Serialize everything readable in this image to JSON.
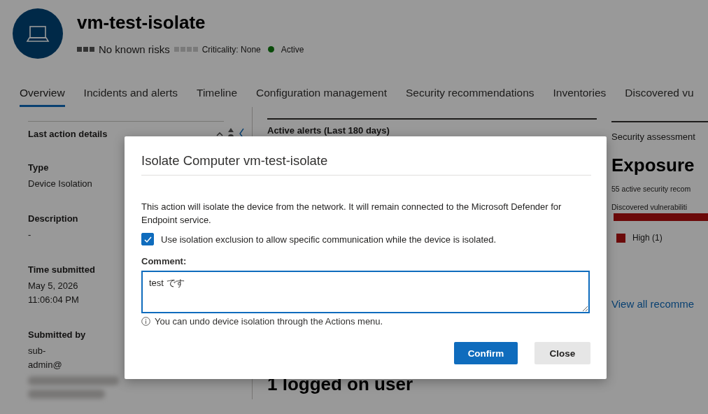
{
  "device": {
    "name": "vm-test-isolate",
    "risk": "No known risks",
    "criticality": "Criticality: None",
    "status": "Active"
  },
  "tabs": [
    {
      "label": "Overview",
      "selected": true
    },
    {
      "label": "Incidents and alerts",
      "selected": false
    },
    {
      "label": "Timeline",
      "selected": false
    },
    {
      "label": "Configuration management",
      "selected": false
    },
    {
      "label": "Security recommendations",
      "selected": false
    },
    {
      "label": "Inventories",
      "selected": false
    },
    {
      "label": "Discovered vu",
      "selected": false
    }
  ],
  "last_action": {
    "title": "Last action details",
    "fields": [
      {
        "label": "Type",
        "lines": [
          "Device Isolation"
        ]
      },
      {
        "label": "Description",
        "lines": [
          "-"
        ]
      },
      {
        "label": "Time submitted",
        "lines": [
          "May 5, 2026",
          "11:06:04 PM"
        ]
      },
      {
        "label": "Submitted by",
        "lines": [
          "sub-",
          "admin@"
        ]
      }
    ]
  },
  "alerts": {
    "title": "Active alerts (Last 180 days)",
    "logged_on": "1 logged on user"
  },
  "security": {
    "title": "Security assessment",
    "exposure": "Exposure",
    "recommendations": "55 active security recom",
    "vulnerabilities": "Discovered vulnerabiliti",
    "legend": [
      {
        "label": "High (1)",
        "color": "#6b0a0a"
      }
    ],
    "link": "View all recomme"
  },
  "dialog": {
    "title": "Isolate Computer vm-test-isolate",
    "message": "This action will isolate the device from the network. It will remain connected to the Microsoft Defender for Endpoint service.",
    "exclusion": {
      "label": "Use isolation exclusion to allow specific communication while the device is isolated.",
      "checked": true
    },
    "comment_label": "Comment:",
    "comment_value": "test です",
    "hint": "You can undo device isolation through the Actions menu.",
    "buttons": [
      {
        "label": "Confirm",
        "kind": "primary"
      },
      {
        "label": "Close",
        "kind": "secondary"
      }
    ]
  }
}
